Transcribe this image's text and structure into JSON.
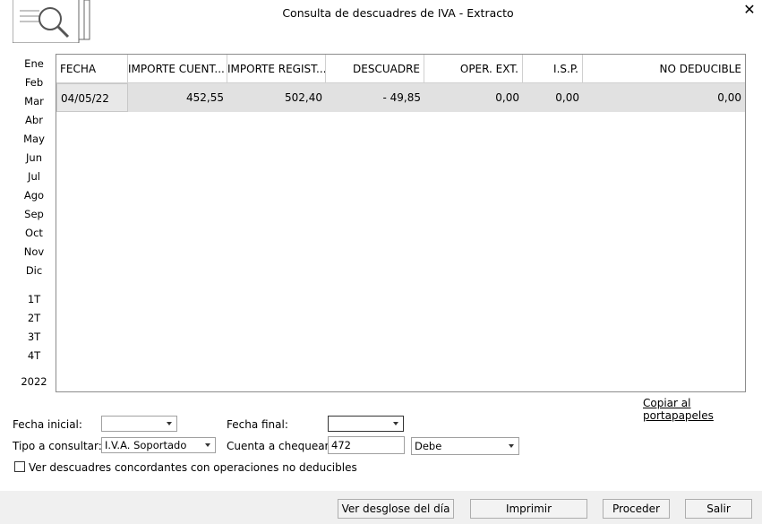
{
  "window": {
    "title": "Consulta de descuadres de IVA - Extracto",
    "close_icon": "close-icon"
  },
  "months": [
    "Ene",
    "Feb",
    "Mar",
    "Abr",
    "May",
    "Jun",
    "Jul",
    "Ago",
    "Sep",
    "Oct",
    "Nov",
    "Dic"
  ],
  "quarters": [
    "1T",
    "2T",
    "3T",
    "4T"
  ],
  "year": "2022",
  "table": {
    "headers": [
      "FECHA",
      "IMPORTE CUENT...",
      "IMPORTE REGIST...",
      "DESCUADRE",
      "OPER. EXT.",
      "I.S.P.",
      "NO DEDUCIBLE"
    ],
    "rows": [
      [
        "04/05/22",
        "452,55",
        "502,40",
        "- 49,85",
        "0,00",
        "0,00",
        "0,00"
      ]
    ]
  },
  "copy_link": "Copiar al portapapeles",
  "form": {
    "fecha_inicial_label": "Fecha inicial:",
    "fecha_inicial_value": "",
    "fecha_final_label": "Fecha final:",
    "fecha_final_value": "",
    "tipo_label": "Tipo a consultar:",
    "tipo_value": "I.V.A. Soportado",
    "cuenta_label": "Cuenta a chequear:",
    "cuenta_value": "472",
    "lado_value": "Debe",
    "checkbox_label": "Ver descuadres concordantes con operaciones no deducibles",
    "checkbox_checked": false
  },
  "buttons": {
    "desglose": "Ver desglose del día",
    "imprimir": "Imprimir",
    "proceder": "Proceder",
    "salir": "Salir"
  }
}
